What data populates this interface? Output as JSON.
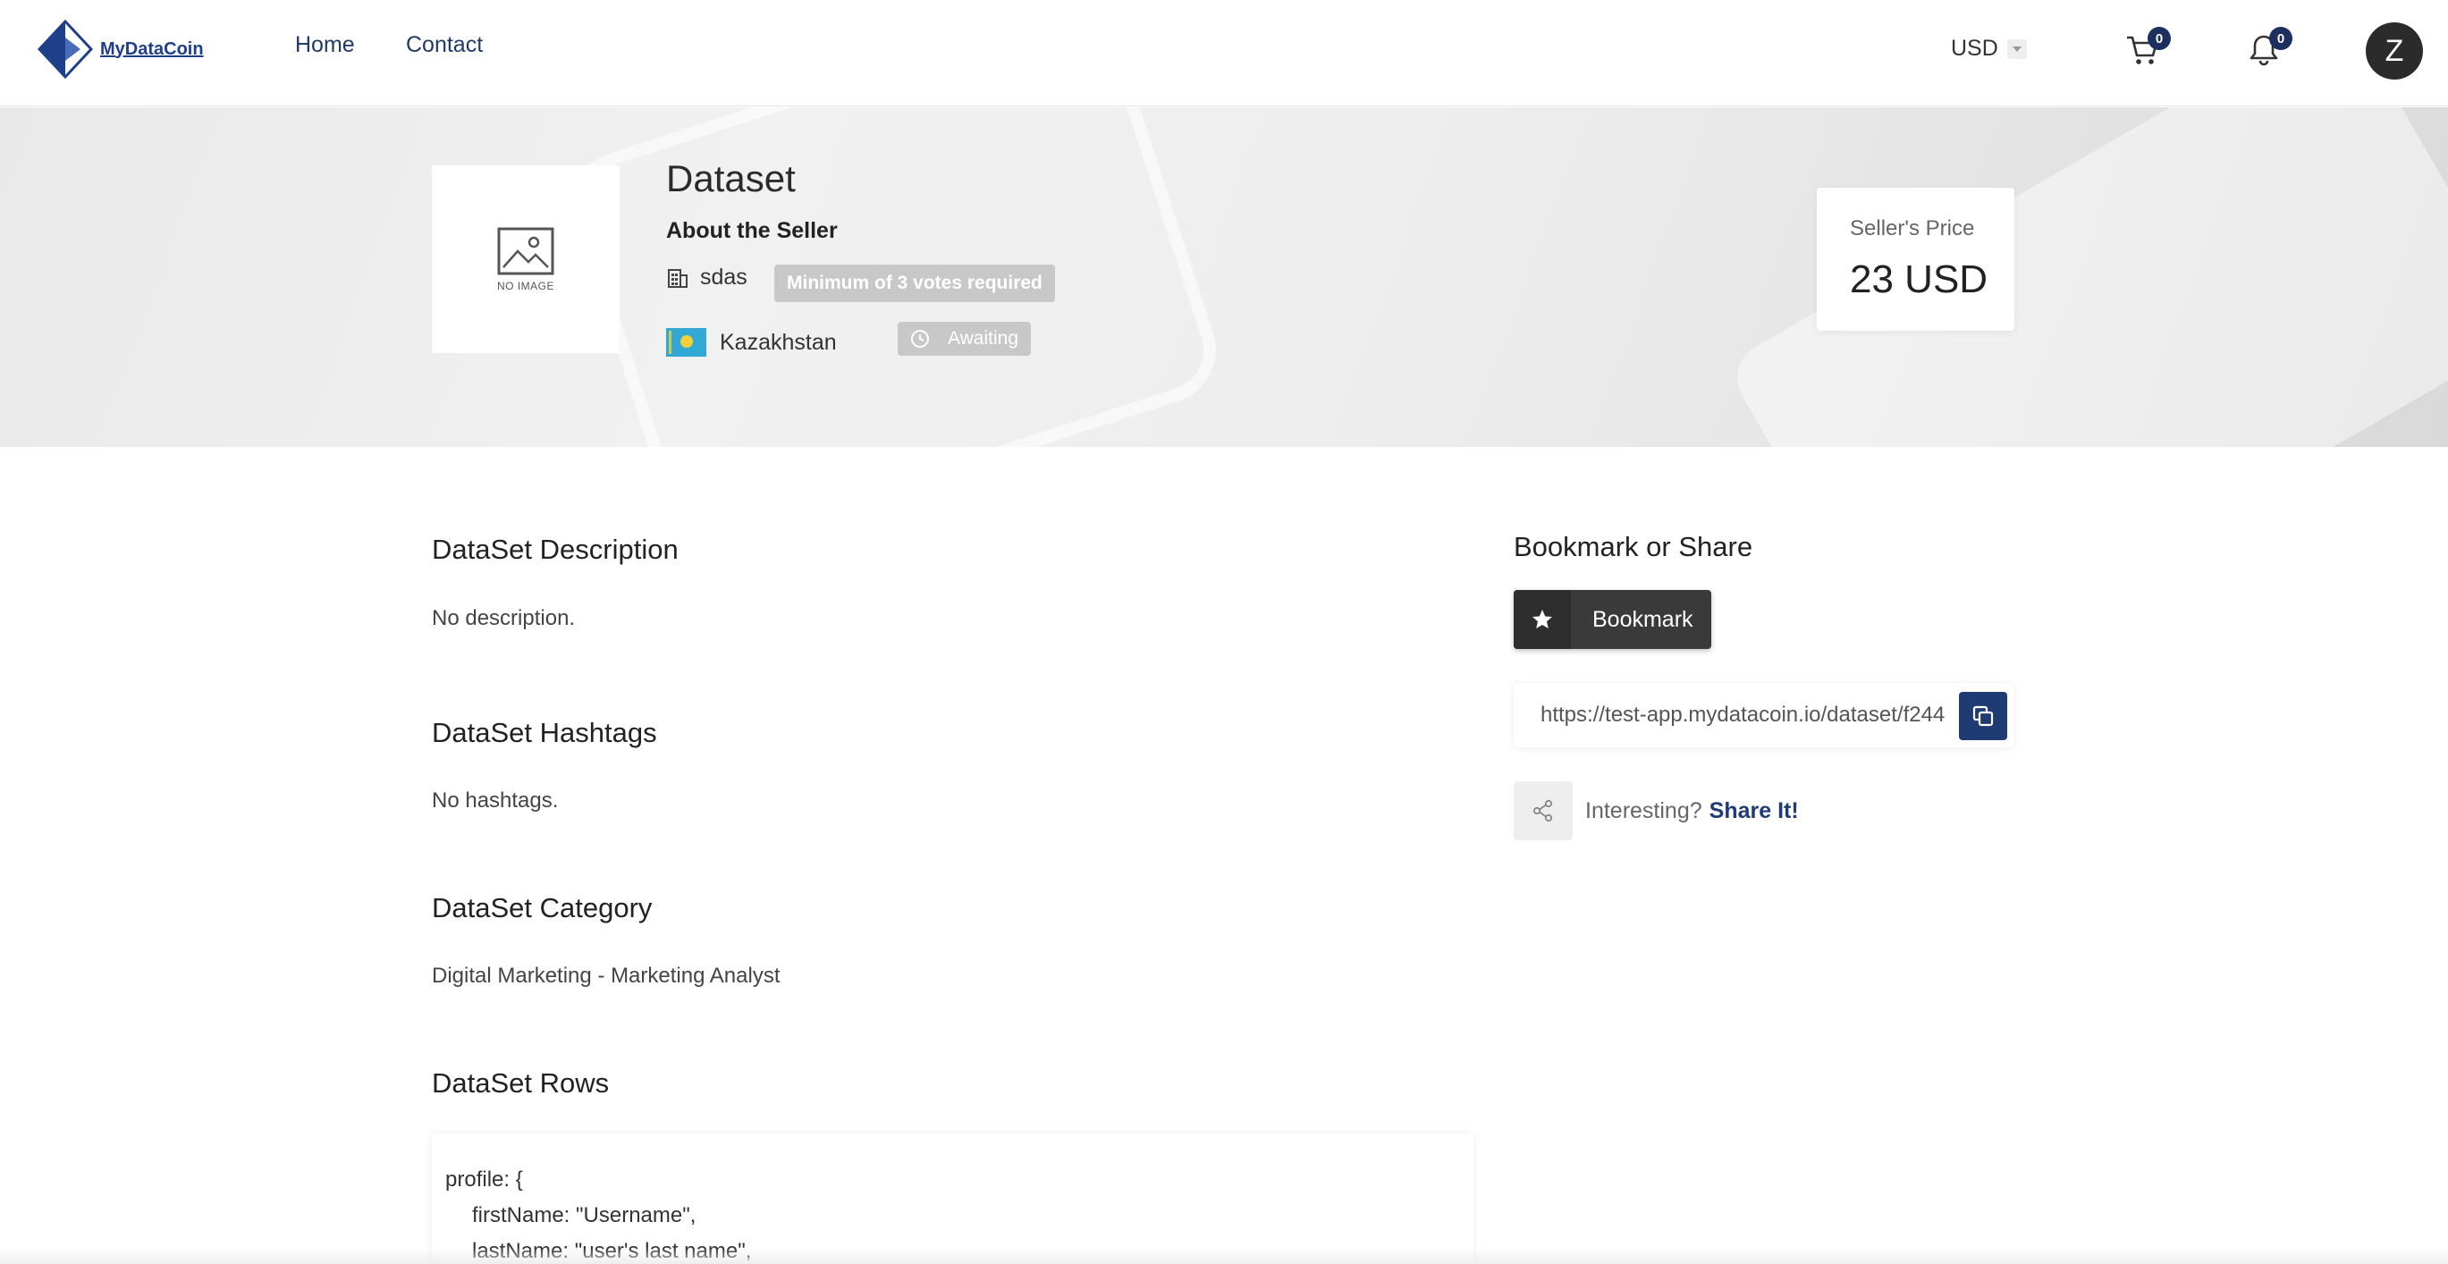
{
  "header": {
    "logo_text": "MyDataCoin",
    "nav": [
      {
        "label": "Home"
      },
      {
        "label": "Contact"
      }
    ],
    "currency": "USD",
    "cart_count": "0",
    "notification_count": "0",
    "avatar_initial": "Z"
  },
  "hero": {
    "no_image_label": "NO IMAGE",
    "title": "Dataset",
    "about_label": "About the Seller",
    "seller_name": "sdas",
    "votes_badge": "Minimum of 3 votes required",
    "country": "Kazakhstan",
    "status_badge": "Awaiting",
    "price_label": "Seller's Price",
    "price_value": "23 USD"
  },
  "main": {
    "description_title": "DataSet Description",
    "description_text": "No description.",
    "hashtags_title": "DataSet Hashtags",
    "hashtags_text": "No hashtags.",
    "category_title": "DataSet Category",
    "category_text": "Digital Marketing - Marketing Analyst",
    "rows_title": "DataSet Rows",
    "rows_code": [
      "profile: {",
      "firstName: \"Username\",",
      "lastName: \"user's last name\","
    ]
  },
  "sidebar": {
    "title": "Bookmark or Share",
    "bookmark_label": "Bookmark",
    "share_url": "https://test-app.mydatacoin.io/dataset/f244",
    "share_prompt": "Interesting?",
    "share_link": "Share It!"
  }
}
